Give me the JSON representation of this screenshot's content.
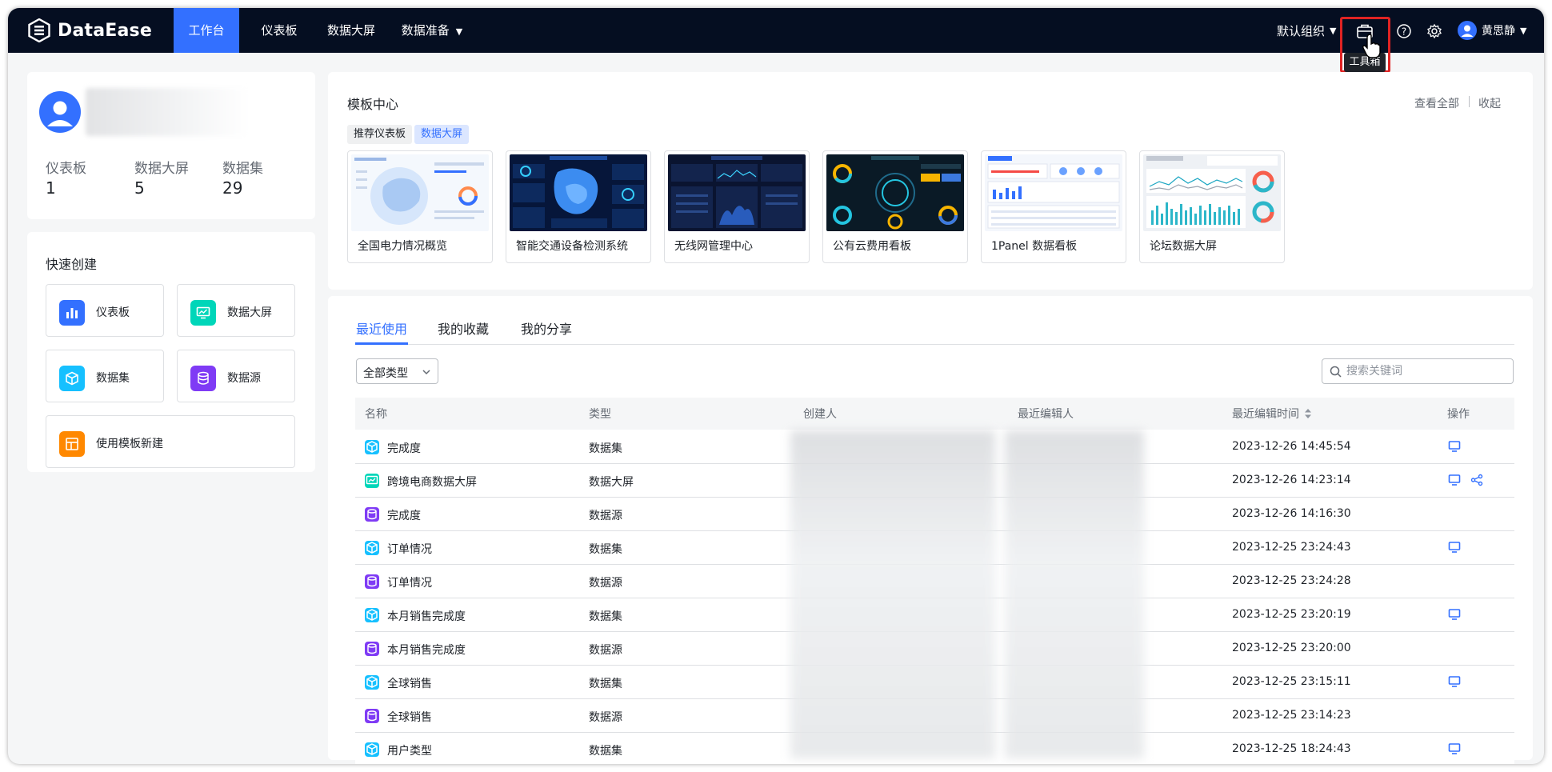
{
  "app": {
    "name": "DataEase"
  },
  "nav": {
    "items": [
      {
        "label": "工作台"
      },
      {
        "label": "仪表板"
      },
      {
        "label": "数据大屏"
      },
      {
        "label": "数据准备"
      }
    ],
    "org": "默认组织",
    "user": "黄思静",
    "toolbox_tooltip": "工具箱"
  },
  "profile": {
    "stats": [
      {
        "label": "仪表板",
        "value": "1"
      },
      {
        "label": "数据大屏",
        "value": "5"
      },
      {
        "label": "数据集",
        "value": "29"
      }
    ]
  },
  "quick_create": {
    "title": "快速创建",
    "items": [
      {
        "label": "仪表板",
        "color": "#3370ff"
      },
      {
        "label": "数据大屏",
        "color": "#00d6b9"
      },
      {
        "label": "数据集",
        "color": "#16c0ff"
      },
      {
        "label": "数据源",
        "color": "#7f3bf5"
      },
      {
        "label": "使用模板新建",
        "color": "#ff8800"
      }
    ]
  },
  "template_center": {
    "title": "模板中心",
    "view_all": "查看全部",
    "collapse": "收起",
    "tags": [
      "推荐仪表板",
      "数据大屏"
    ],
    "templates": [
      {
        "name": "全国电力情况概览"
      },
      {
        "name": "智能交通设备检测系统"
      },
      {
        "name": "无线网管理中心"
      },
      {
        "name": "公有云费用看板"
      },
      {
        "name": "1Panel 数据看板"
      },
      {
        "name": "论坛数据大屏"
      }
    ]
  },
  "tabs": [
    "最近使用",
    "我的收藏",
    "我的分享"
  ],
  "filter": {
    "type_select": "全部类型",
    "search_placeholder": "搜索关键词"
  },
  "table": {
    "headers": [
      "名称",
      "类型",
      "创建人",
      "最近编辑人",
      "最近编辑时间",
      "操作"
    ],
    "rows": [
      {
        "name": "完成度",
        "type": "数据集",
        "time": "2023-12-26 14:45:54",
        "kind": "dataset",
        "ops": [
          "preview"
        ]
      },
      {
        "name": "跨境电商数据大屏",
        "type": "数据大屏",
        "time": "2023-12-26 14:23:14",
        "kind": "screen",
        "ops": [
          "preview",
          "share"
        ]
      },
      {
        "name": "完成度",
        "type": "数据源",
        "time": "2023-12-26 14:16:30",
        "kind": "datasource",
        "ops": []
      },
      {
        "name": "订单情况",
        "type": "数据集",
        "time": "2023-12-25 23:24:43",
        "kind": "dataset",
        "ops": [
          "preview"
        ]
      },
      {
        "name": "订单情况",
        "type": "数据源",
        "time": "2023-12-25 23:24:28",
        "kind": "datasource",
        "ops": []
      },
      {
        "name": "本月销售完成度",
        "type": "数据集",
        "time": "2023-12-25 23:20:19",
        "kind": "dataset",
        "ops": [
          "preview"
        ]
      },
      {
        "name": "本月销售完成度",
        "type": "数据源",
        "time": "2023-12-25 23:20:00",
        "kind": "datasource",
        "ops": []
      },
      {
        "name": "全球销售",
        "type": "数据集",
        "time": "2023-12-25 23:15:11",
        "kind": "dataset",
        "ops": [
          "preview"
        ]
      },
      {
        "name": "全球销售",
        "type": "数据源",
        "time": "2023-12-25 23:14:23",
        "kind": "datasource",
        "ops": []
      },
      {
        "name": "用户类型",
        "type": "数据集",
        "time": "2023-12-25 18:24:43",
        "kind": "dataset",
        "ops": [
          "preview"
        ]
      }
    ]
  },
  "colors": {
    "primary": "#3370ff",
    "nav_bg": "#050e21",
    "highlight": "#e02323"
  }
}
